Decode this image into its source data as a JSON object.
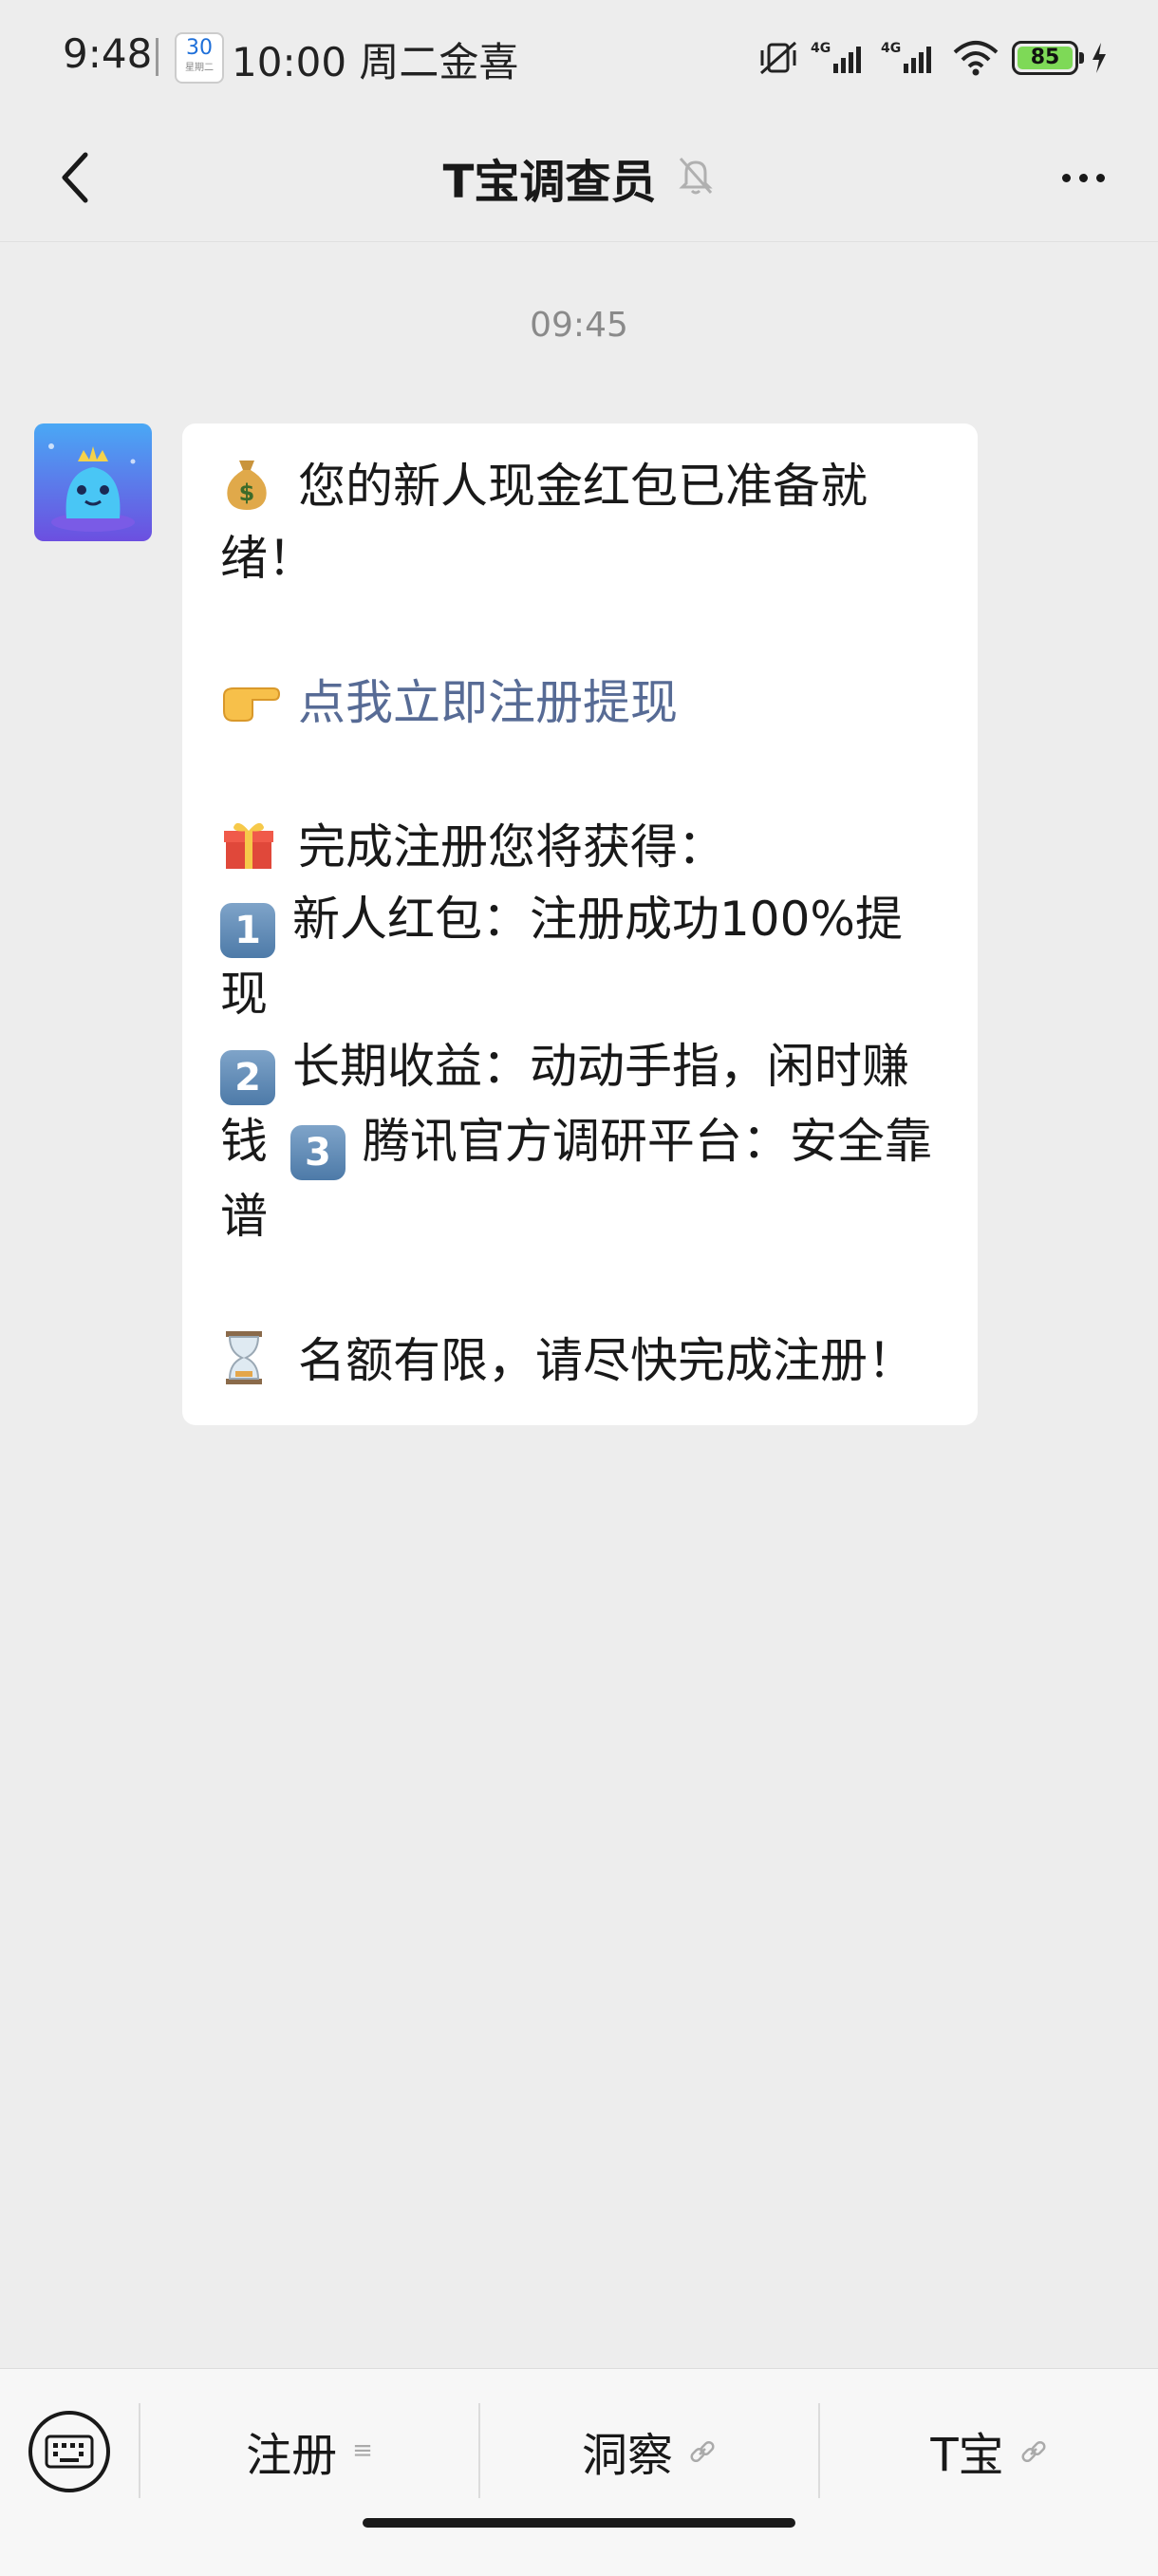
{
  "status_bar": {
    "time": "9:48",
    "calendar_day": "30",
    "calendar_weekday": "星期二",
    "notification": "10:00 周二金喜日",
    "battery": "85"
  },
  "nav": {
    "title": "T宝调查员"
  },
  "chat": {
    "timestamp": "09:45",
    "message": {
      "line1": "您的新人现金红包已准备就绪！",
      "link": "点我立即注册提现",
      "gift_line": "完成注册您将获得：",
      "item1_num": "1",
      "item1": "新人红包：注册成功100%提现",
      "item2_num": "2",
      "item2": "长期收益：动动手指，闲时赚钱",
      "item3_num": "3",
      "item3": "腾讯官方调研平台：安全靠谱",
      "footer": "名额有限，请尽快完成注册！"
    }
  },
  "bottom_menu": {
    "items": [
      {
        "label": "注册",
        "icon": "menu-list-icon"
      },
      {
        "label": "洞察",
        "icon": "link-icon"
      },
      {
        "label": "T宝",
        "icon": "link-icon"
      }
    ]
  }
}
